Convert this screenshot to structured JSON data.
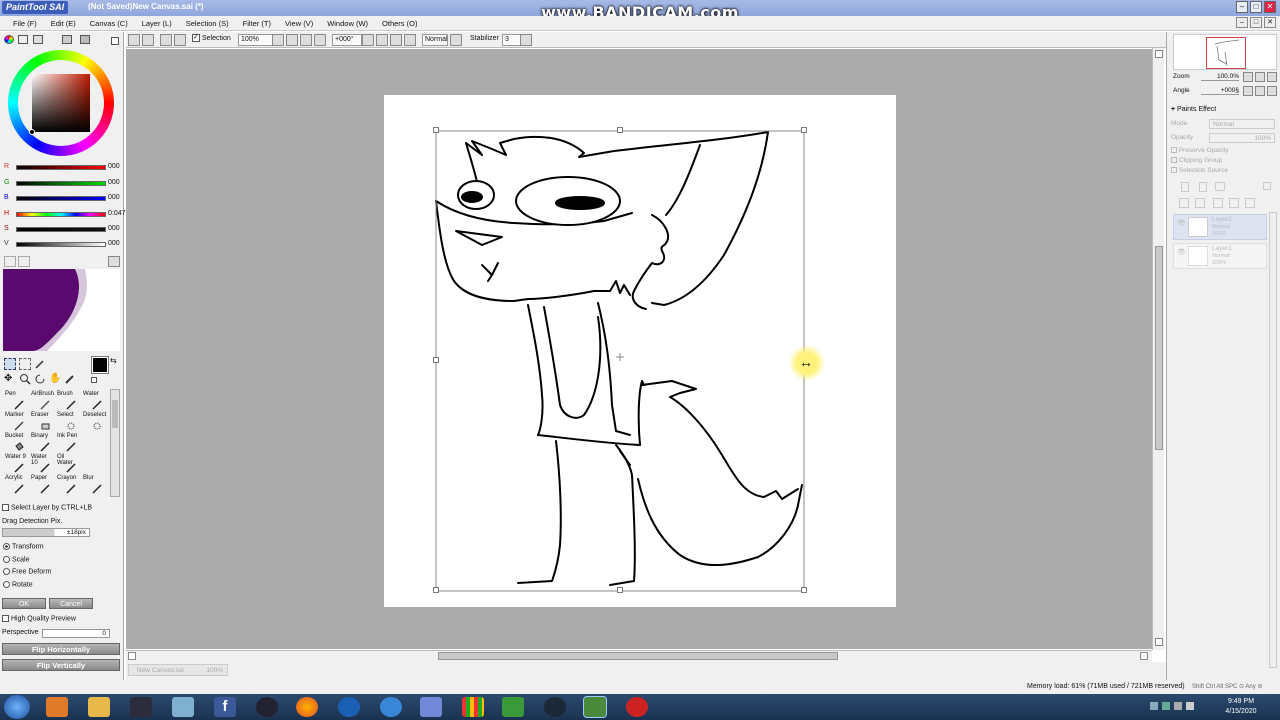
{
  "app": {
    "logo": "PaintTool SAI",
    "title": "(Not Saved)New Canvas.sai (*)",
    "watermark": "www.BANDICAM.com"
  },
  "window_buttons": [
    "–",
    "□",
    "✕"
  ],
  "menu": [
    "File (F)",
    "Edit (E)",
    "Canvas (C)",
    "Layer (L)",
    "Selection (S)",
    "Filter (T)",
    "View (V)",
    "Window (W)",
    "Others (O)"
  ],
  "toolbar": {
    "selection_label": "Selection",
    "zoom": "100%",
    "angle": "+000°",
    "blend": "Normal",
    "stabilizer_label": "Stabilizer",
    "stabilizer_value": "3"
  },
  "color_sliders": [
    {
      "label": "R",
      "value": "000",
      "color": "#d00000"
    },
    {
      "label": "G",
      "value": "000",
      "color": "#00b000"
    },
    {
      "label": "B",
      "value": "000",
      "color": "#0000d0"
    },
    {
      "label": "H",
      "value": "0:047",
      "color": "rainbow"
    },
    {
      "label": "S",
      "value": "000",
      "color": "#000"
    },
    {
      "label": "V",
      "value": "000",
      "color": "#000"
    }
  ],
  "tools": [
    [
      "Pen",
      "AirBrush",
      "Brush",
      "Water"
    ],
    [
      "Marker",
      "Eraser",
      "Select",
      "Deselect"
    ],
    [
      "Bucket",
      "Binary",
      "Ink Pen",
      ""
    ],
    [
      "Water 9",
      "Water 10",
      "Oil Water",
      ""
    ],
    [
      "Acrylic",
      "Paper",
      "Crayon",
      "Blur"
    ]
  ],
  "transform": {
    "select_layer": "Select Layer by CTRL+LB",
    "drag_detection_label": "Drag Detection Pix.",
    "drag_detection_value": "±18pix",
    "modes": [
      "Transform",
      "Scale",
      "Free Deform",
      "Rotate"
    ],
    "selected_mode": "Transform",
    "ok": "OK",
    "cancel": "Cancel",
    "high_quality": "High Quality Preview",
    "perspective_label": "Perspective",
    "perspective_value": "0",
    "flip_h": "Flip Horizontally",
    "flip_v": "Flip Vertically"
  },
  "right_panel": {
    "zoom_label": "Zoom",
    "zoom_value": "100.0%",
    "angle_label": "Angle",
    "angle_value": "+000§",
    "paints_effect": "Paints Effect",
    "mode_label": "Mode",
    "mode_value": "Normal",
    "opacity_label": "Opacity",
    "opacity_value": "100%",
    "checks": [
      "Preserve Opacity",
      "Clipping Group",
      "Selection Source"
    ],
    "layers": [
      {
        "name": "Layer2",
        "mode": "Normal",
        "opacity": "100%"
      },
      {
        "name": "Layer1",
        "mode": "Normal",
        "opacity": "100%"
      }
    ]
  },
  "document_tab": {
    "name": "New Canvas.sai",
    "zoom": "100%"
  },
  "status": {
    "memory": "Memory load: 61% (71MB used / 721MB reserved)",
    "keys": "Shift Ctrl Alt SPC ⊙ Any ⊘"
  },
  "taskbar": {
    "time": "9:49 PM",
    "date": "4/15/2020"
  },
  "colors": {
    "accent_purple": "#5a0a6e",
    "canvas_bg": "#ababab"
  }
}
